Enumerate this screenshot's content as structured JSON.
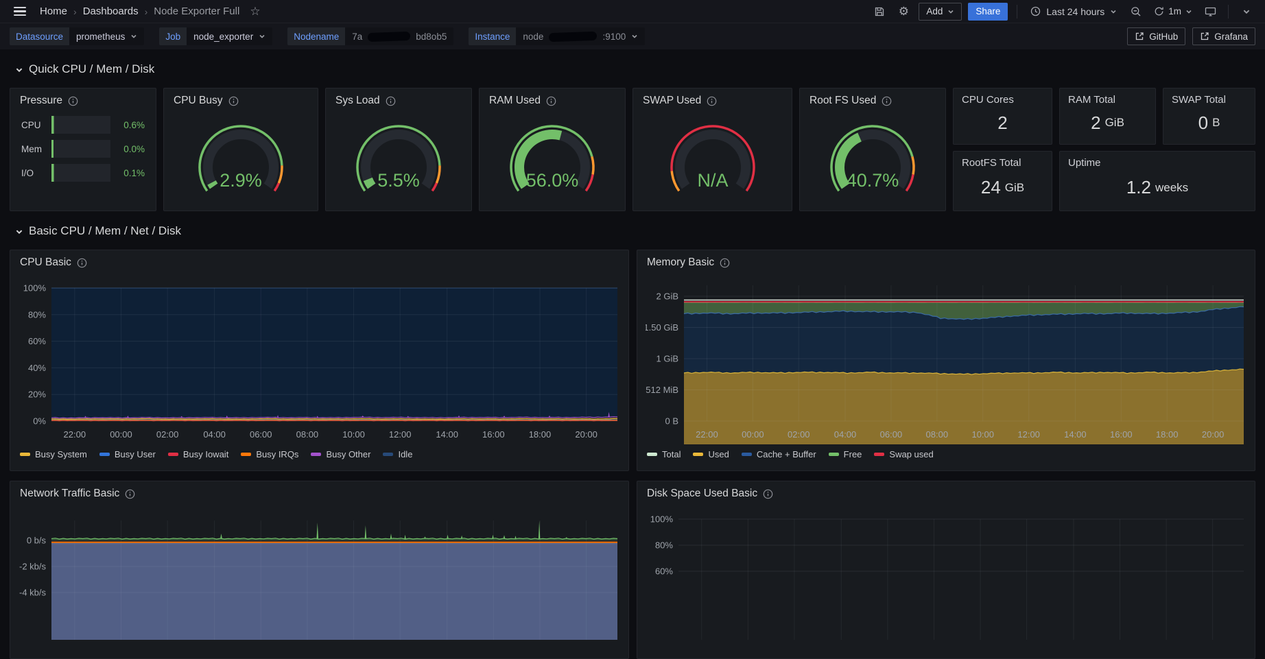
{
  "topnav": {
    "breadcrumb": {
      "home": "Home",
      "dashboards": "Dashboards",
      "current": "Node Exporter Full",
      "separator": "›"
    },
    "add_label": "Add",
    "share_label": "Share",
    "time_range": "Last 24 hours",
    "refresh_interval": "1m"
  },
  "variables": {
    "datasource": {
      "label": "Datasource",
      "value": "prometheus"
    },
    "job": {
      "label": "Job",
      "value": "node_exporter"
    },
    "nodename": {
      "label": "Nodename",
      "value_prefix": "7a",
      "value_suffix": "bd8ob5",
      "redacted": true
    },
    "instance": {
      "label": "Instance",
      "value_prefix": "node",
      "value_suffix": ":9100",
      "redacted": true
    },
    "links": {
      "github": "GitHub",
      "grafana": "Grafana"
    }
  },
  "sections": {
    "quick": "Quick CPU / Mem / Disk",
    "basic": "Basic CPU / Mem / Net / Disk"
  },
  "pressure": {
    "title": "Pressure",
    "rows": [
      {
        "label": "CPU",
        "value": "0.6%",
        "pct": 0.6
      },
      {
        "label": "Mem",
        "value": "0.0%",
        "pct": 0.0
      },
      {
        "label": "I/O",
        "value": "0.1%",
        "pct": 0.1
      }
    ]
  },
  "gauges": [
    {
      "title": "CPU Busy",
      "display": "2.9%",
      "value": 2.9,
      "steps": [
        {
          "to": 0.85,
          "color": "#73bf69"
        },
        {
          "to": 0.95,
          "color": "#ff9830"
        },
        {
          "to": 1,
          "color": "#e02f44"
        }
      ]
    },
    {
      "title": "Sys Load",
      "display": "5.5%",
      "value": 5.5,
      "steps": [
        {
          "to": 0.85,
          "color": "#73bf69"
        },
        {
          "to": 0.95,
          "color": "#ff9830"
        },
        {
          "to": 1,
          "color": "#e02f44"
        }
      ]
    },
    {
      "title": "RAM Used",
      "display": "56.0%",
      "value": 56.0,
      "steps": [
        {
          "to": 0.8,
          "color": "#73bf69"
        },
        {
          "to": 0.9,
          "color": "#ff9830"
        },
        {
          "to": 1,
          "color": "#e02f44"
        }
      ]
    },
    {
      "title": "SWAP Used",
      "display": "N/A",
      "value": null,
      "steps": [
        {
          "to": 0.12,
          "color": "#ff9830"
        },
        {
          "to": 1,
          "color": "#e02f44"
        }
      ]
    },
    {
      "title": "Root FS Used",
      "display": "40.7%",
      "value": 40.7,
      "steps": [
        {
          "to": 0.8,
          "color": "#73bf69"
        },
        {
          "to": 0.9,
          "color": "#ff9830"
        },
        {
          "to": 1,
          "color": "#e02f44"
        }
      ]
    }
  ],
  "stats": [
    {
      "title": "CPU Cores",
      "value": "2",
      "unit": ""
    },
    {
      "title": "RAM Total",
      "value": "2",
      "unit": "GiB"
    },
    {
      "title": "SWAP Total",
      "value": "0",
      "unit": "B"
    },
    {
      "title": "RootFS Total",
      "value": "24",
      "unit": "GiB"
    },
    {
      "title": "Uptime",
      "value": "1.2",
      "unit": "weeks"
    }
  ],
  "chart_data": [
    {
      "id": "cpu_basic",
      "type": "area",
      "title": "CPU Basic",
      "ylim": [
        0,
        100
      ],
      "grid": true,
      "legend_position": "bottom",
      "x_ticks": [
        "22:00",
        "00:00",
        "02:00",
        "04:00",
        "06:00",
        "08:00",
        "10:00",
        "12:00",
        "14:00",
        "16:00",
        "18:00",
        "20:00"
      ],
      "y_ticks": [
        {
          "label": "100%",
          "v": 100
        },
        {
          "label": "80%",
          "v": 80
        },
        {
          "label": "60%",
          "v": 60
        },
        {
          "label": "40%",
          "v": 40
        },
        {
          "label": "20%",
          "v": 20
        },
        {
          "label": "0%",
          "v": 0
        }
      ],
      "legend": [
        {
          "label": "Busy System",
          "color": "#eab839"
        },
        {
          "label": "Busy User",
          "color": "#3274d9"
        },
        {
          "label": "Busy Iowait",
          "color": "#e02f44"
        },
        {
          "label": "Busy IRQs",
          "color": "#ff780a"
        },
        {
          "label": "Busy Other",
          "color": "#a352cc"
        },
        {
          "label": "Idle",
          "color": "#274a78"
        }
      ],
      "series": [
        {
          "name": "Idle",
          "color": "rgba(87,148,242,0.30)",
          "width": 1,
          "fill": "#0e2036",
          "values": [
            100,
            100,
            100,
            100,
            100,
            100,
            100,
            100,
            100,
            100,
            100,
            100,
            100,
            100,
            100,
            100,
            100,
            100,
            100,
            100,
            100,
            100,
            100,
            100,
            100
          ],
          "lower_series": "Busy Other",
          "jitter": 0
        },
        {
          "name": "Busy User",
          "color": "#3274d9",
          "width": 1,
          "values": [
            0.9,
            0.9,
            0.9,
            0.9,
            0.9,
            0.9,
            0.9,
            0.9,
            0.9,
            0.9,
            0.9,
            0.9,
            0.9,
            0.9,
            0.9,
            0.9,
            0.9,
            0.9,
            0.9,
            0.9,
            0.9,
            0.9,
            0.9,
            0.9,
            0.9
          ],
          "jitter": 0.1
        },
        {
          "name": "Busy Iowait",
          "color": "#e02f44",
          "width": 1,
          "values": [
            0.3,
            0.3,
            0.3,
            0.3,
            0.3,
            0.3,
            0.3,
            0.3,
            0.3,
            0.3,
            0.3,
            0.3,
            0.3,
            0.3,
            0.3,
            0.3,
            0.3,
            0.3,
            0.3,
            0.3,
            0.3,
            0.3,
            0.3,
            0.3,
            0.3
          ],
          "jitter": 0.15
        },
        {
          "name": "Busy IRQs",
          "color": "#ff780a",
          "width": 1,
          "values": [
            0.55,
            0.55,
            0.55,
            0.55,
            0.55,
            0.55,
            0.55,
            0.55,
            0.55,
            0.55,
            0.55,
            0.55,
            0.55,
            0.55,
            0.55,
            0.55,
            0.55,
            0.55,
            0.55,
            0.55,
            0.55,
            0.55,
            0.55,
            0.55,
            0.55
          ],
          "jitter": 0.1
        },
        {
          "name": "Busy Other",
          "color": "#a352cc",
          "width": 1.2,
          "values": [
            2.4,
            2.3,
            2.5,
            2.4,
            2.6,
            2.4,
            2.5,
            2.6,
            2.4,
            2.7,
            2.5,
            2.6,
            2.5,
            2.8,
            2.6,
            2.7,
            2.5,
            2.6,
            2.7,
            2.6,
            2.8,
            2.6,
            2.7,
            2.8,
            3.1
          ],
          "jitter": 0.25,
          "spikes": [
            {
              "f": 0.06,
              "v": 3.9
            },
            {
              "f": 0.135,
              "v": 4.1
            },
            {
              "f": 0.23,
              "v": 3.8
            },
            {
              "f": 0.31,
              "v": 4.3
            },
            {
              "f": 0.4,
              "v": 4.6
            },
            {
              "f": 0.47,
              "v": 4.0
            },
            {
              "f": 0.55,
              "v": 4.2
            },
            {
              "f": 0.63,
              "v": 3.9
            },
            {
              "f": 0.72,
              "v": 4.4
            },
            {
              "f": 0.8,
              "v": 4.1
            },
            {
              "f": 0.88,
              "v": 4.3
            },
            {
              "f": 0.985,
              "v": 6.8
            }
          ]
        },
        {
          "name": "Busy System",
          "color": "#eab839",
          "width": 1.4,
          "values": [
            1.5,
            1.4,
            1.6,
            1.5,
            1.7,
            1.4,
            1.5,
            1.6,
            1.4,
            1.7,
            1.5,
            1.6,
            1.5,
            1.7,
            1.5,
            1.6,
            1.4,
            1.5,
            1.6,
            1.5,
            1.7,
            1.5,
            1.6,
            1.5,
            1.8
          ],
          "jitter": 0.2
        }
      ]
    },
    {
      "id": "memory_basic",
      "type": "area",
      "title": "Memory Basic",
      "ylim": [
        0,
        2.176
      ],
      "unit": "GiB",
      "grid": true,
      "legend_position": "bottom",
      "x_ticks": [
        "22:00",
        "00:00",
        "02:00",
        "04:00",
        "06:00",
        "08:00",
        "10:00",
        "12:00",
        "14:00",
        "16:00",
        "18:00",
        "20:00"
      ],
      "y_ticks": [
        {
          "label": "2 GiB",
          "v": 2
        },
        {
          "label": "1.50 GiB",
          "v": 1.5
        },
        {
          "label": "1 GiB",
          "v": 1
        },
        {
          "label": "512 MiB",
          "v": 0.5
        },
        {
          "label": "0 B",
          "v": 0
        }
      ],
      "legend": [
        {
          "label": "Total",
          "color": "#cde8cf"
        },
        {
          "label": "Used",
          "color": "#eab839"
        },
        {
          "label": "Cache + Buffer",
          "color": "#2a5a9e"
        },
        {
          "label": "Free",
          "color": "#73bf69"
        },
        {
          "label": "Swap used",
          "color": "#e02f44"
        }
      ],
      "series": [
        {
          "name": "Free",
          "color": "rgba(115,191,105,0.65)",
          "width": 1,
          "fill": "#41603c",
          "values": [
            1.9,
            1.9,
            1.9,
            1.9,
            1.9,
            1.9,
            1.9,
            1.9,
            1.9,
            1.9,
            1.9,
            1.9,
            1.9,
            1.9,
            1.9,
            1.9,
            1.9,
            1.9,
            1.9,
            1.9,
            1.9,
            1.9,
            1.9,
            1.9,
            1.9
          ],
          "lower_series": "Cache + Buffer",
          "jitter": 0.003
        },
        {
          "name": "Cache + Buffer",
          "color": "#3b6ca5",
          "width": 1.2,
          "fill": "#14273e",
          "values": [
            1.72,
            1.73,
            1.72,
            1.73,
            1.73,
            1.74,
            1.75,
            1.76,
            1.75,
            1.75,
            1.74,
            1.65,
            1.63,
            1.65,
            1.68,
            1.7,
            1.71,
            1.72,
            1.72,
            1.73,
            1.72,
            1.73,
            1.75,
            1.8,
            1.83
          ],
          "lower_series": "Used",
          "jitter": 0.012
        },
        {
          "name": "Used",
          "color": "#d9b339",
          "width": 1.2,
          "fill": "#8b712d",
          "values": [
            0.77,
            0.78,
            0.77,
            0.78,
            0.77,
            0.78,
            0.78,
            0.77,
            0.78,
            0.77,
            0.77,
            0.76,
            0.75,
            0.76,
            0.77,
            0.77,
            0.78,
            0.77,
            0.78,
            0.77,
            0.78,
            0.77,
            0.78,
            0.81,
            0.83
          ],
          "lower": 0,
          "jitter": 0.01
        },
        {
          "name": "Swap used",
          "color": "#e02f44",
          "width": 1.8,
          "values": [
            1.91,
            1.91,
            1.91,
            1.91,
            1.91,
            1.91,
            1.91,
            1.91,
            1.91,
            1.91,
            1.91,
            1.91,
            1.91,
            1.91,
            1.91,
            1.91,
            1.91,
            1.91,
            1.91,
            1.91,
            1.91,
            1.91,
            1.91,
            1.91,
            1.91
          ],
          "jitter": 0
        },
        {
          "name": "Total",
          "color": "#dde8dc",
          "width": 1.5,
          "values": [
            1.94,
            1.94,
            1.94,
            1.94,
            1.94,
            1.94,
            1.94,
            1.94,
            1.94,
            1.94,
            1.94,
            1.94,
            1.94,
            1.94,
            1.94,
            1.94,
            1.94,
            1.94,
            1.94,
            1.94,
            1.94,
            1.94,
            1.94,
            1.94,
            1.94
          ],
          "jitter": 0
        }
      ]
    },
    {
      "id": "network_basic",
      "type": "area",
      "title": "Network Traffic Basic",
      "unit": "b/s",
      "grid": true,
      "clipped_by_viewport": true,
      "y_ticks": [
        {
          "label": "0 b/s",
          "v": 0
        },
        {
          "label": "-2 kb/s",
          "v": -2000
        },
        {
          "label": "-4 kb/s",
          "v": -4000
        }
      ],
      "series": [
        {
          "name": "transmit-area",
          "color": "#6c7ca6",
          "width": 1,
          "fill": "#525f86",
          "values": [
            -240,
            -240,
            -240,
            -240,
            -240,
            -240,
            -240,
            -240,
            -240,
            -240,
            -240,
            -240,
            -240,
            -240,
            -240,
            -240,
            -240,
            -240,
            -240,
            -240,
            -240,
            -240,
            -240,
            -240,
            -240
          ],
          "lower": -99999,
          "jitter": 0
        },
        {
          "name": "zero-line-orange",
          "color": "#ff780a",
          "width": 2,
          "values": [
            -150,
            -150,
            -150,
            -150,
            -150,
            -150,
            -150,
            -150,
            -150,
            -150,
            -150,
            -150,
            -150,
            -150,
            -150,
            -150,
            -150,
            -150,
            -150,
            -150,
            -150,
            -150,
            -150,
            -150,
            -150
          ],
          "jitter": 0
        },
        {
          "name": "receive",
          "color": "#73bf69",
          "width": 1.2,
          "fill": "#2c4a33",
          "values": [
            130,
            130,
            130,
            130,
            130,
            130,
            130,
            130,
            130,
            130,
            130,
            130,
            130,
            130,
            130,
            130,
            130,
            130,
            130,
            130,
            130,
            130,
            130,
            130,
            130
          ],
          "lower": 0,
          "jitter": 40,
          "spikes": [
            {
              "f": 0.3,
              "v": 520
            },
            {
              "f": 0.47,
              "v": 1350
            },
            {
              "f": 0.555,
              "v": 1150
            },
            {
              "f": 0.6,
              "v": 520
            },
            {
              "f": 0.625,
              "v": 430
            },
            {
              "f": 0.66,
              "v": 300
            },
            {
              "f": 0.7,
              "v": 430
            },
            {
              "f": 0.725,
              "v": 380
            },
            {
              "f": 0.78,
              "v": 430
            },
            {
              "f": 0.8,
              "v": 400
            },
            {
              "f": 0.82,
              "v": 360
            },
            {
              "f": 0.862,
              "v": 1500
            },
            {
              "f": 0.91,
              "v": 260
            }
          ]
        }
      ]
    },
    {
      "id": "disk_basic",
      "type": "area",
      "title": "Disk Space Used Basic",
      "unit": "percent",
      "grid": true,
      "clipped_by_viewport": true,
      "y_ticks": [
        {
          "label": "100%",
          "v": 100
        },
        {
          "label": "80%",
          "v": 80
        },
        {
          "label": "60%",
          "v": 60
        }
      ],
      "series": []
    }
  ]
}
